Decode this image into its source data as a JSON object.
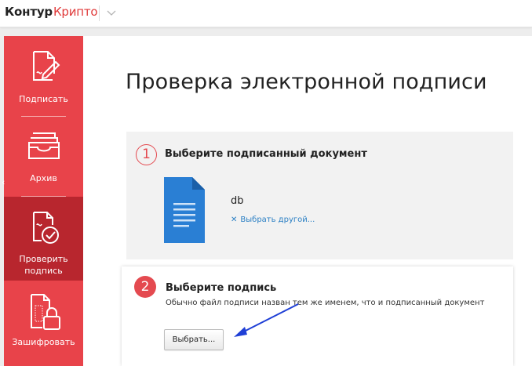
{
  "header": {
    "logo_part1": "Контур",
    "logo_part2": "Крипто"
  },
  "sidebar": {
    "items": [
      {
        "label": "Подписать",
        "icon": "sign-document-icon"
      },
      {
        "label": "Архив",
        "icon": "archive-tray-icon"
      },
      {
        "label_line1": "Проверить",
        "label_line2": "подпись",
        "icon": "verify-signature-icon",
        "active": true
      },
      {
        "label": "Зашифровать",
        "icon": "encrypt-lock-icon"
      }
    ],
    "collapse_glyph": "‹"
  },
  "main": {
    "title": "Проверка электронной подписи",
    "step1": {
      "number": "1",
      "title": "Выберите подписанный документ",
      "file_name": "db",
      "choose_other_x": "✕",
      "choose_other": "Выбрать другой..."
    },
    "step2": {
      "number": "2",
      "title": "Выберите подпись",
      "subtitle": "Обычно файл подписи назван тем же именем, что и подписанный документ",
      "button_label": "Выбрать..."
    }
  },
  "colors": {
    "sidebar_red": "#e8434a",
    "sidebar_active": "#b8262e",
    "step_red": "#e44a50",
    "link_blue": "#2a7fc4",
    "doc_blue": "#2a7fd4",
    "annotation_blue": "#1f3fd6"
  }
}
